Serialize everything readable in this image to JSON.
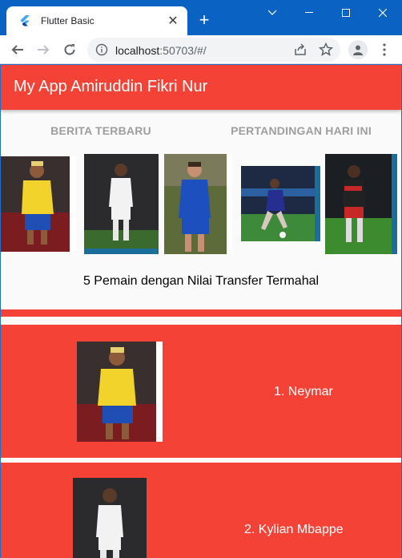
{
  "browser": {
    "tab_title": "Flutter Basic",
    "url_host": "localhost",
    "url_rest": ":50703/#/",
    "favicon": "flutter-icon"
  },
  "app": {
    "title": "My App Amiruddin Fikri Nur",
    "tabs": [
      {
        "label": "BERITA TERBARU"
      },
      {
        "label": "PERTANDINGAN HARI INI"
      }
    ],
    "gallery_caption": "5 Pemain dengan Nilai Transfer Termahal",
    "players": [
      {
        "label": "1. Neymar",
        "kit": "brazil-yellow"
      },
      {
        "label": "2. Kylian Mbappe",
        "kit": "psg-white"
      }
    ]
  },
  "colors": {
    "primary": "#f44336",
    "titlebar": "#0a62c3",
    "tab_inactive_text": "#9e9e9e"
  }
}
